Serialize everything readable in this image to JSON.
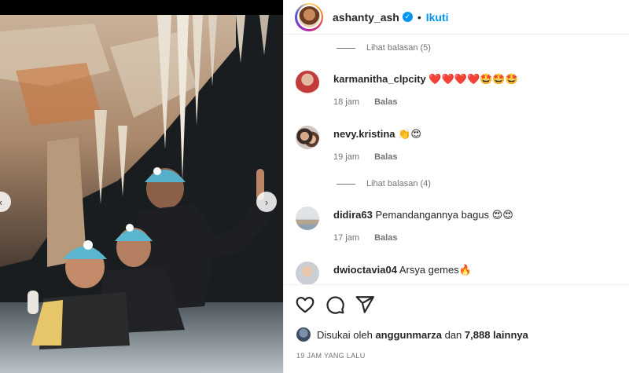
{
  "post": {
    "username": "ashanty_ash",
    "verified_icon": "verified-badge-icon",
    "separator": "•",
    "follow_label": "Ikuti"
  },
  "comments": [
    {
      "type": "replies",
      "label": "Lihat balasan (5)"
    },
    {
      "type": "comment",
      "username": "karmanitha_clpcity",
      "text": "❤️❤️❤️❤️🤩🤩🤩",
      "time": "18 jam",
      "reply": "Balas"
    },
    {
      "type": "comment",
      "username": "nevy.kristina",
      "text": "👏😍",
      "time": "19 jam",
      "reply": "Balas"
    },
    {
      "type": "replies",
      "label": "Lihat balasan (4)"
    },
    {
      "type": "comment",
      "username": "didira63",
      "text": "Pemandangannya bagus 😍😍",
      "time": "17 jam",
      "reply": "Balas"
    },
    {
      "type": "comment",
      "username": "dwioctavia04",
      "text": "Arsya gemes🔥"
    }
  ],
  "actions": {
    "icons": [
      "heart-icon",
      "comment-icon",
      "share-icon"
    ]
  },
  "likes": {
    "prefix": "Disukai oleh",
    "liker": "anggunmarza",
    "middle": "dan",
    "count": "7,888 lainnya"
  },
  "timestamp": "19 JAM YANG LALU",
  "colors": {
    "accent": "#0095f6",
    "text": "#262626",
    "muted": "#737373"
  }
}
